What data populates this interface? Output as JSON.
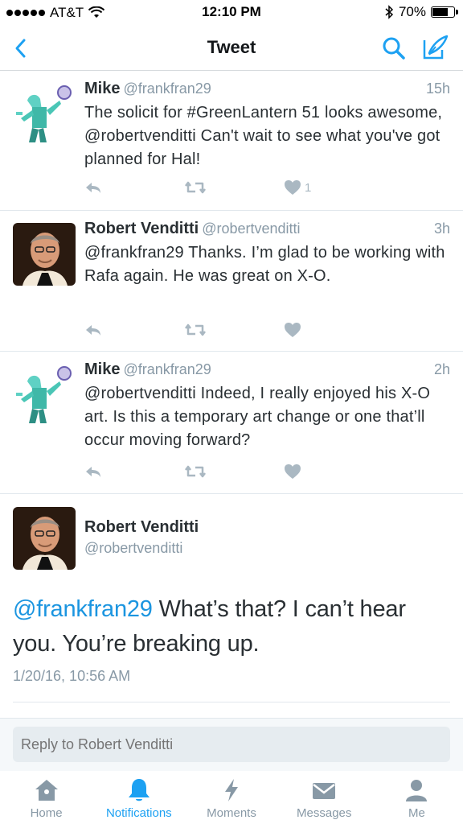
{
  "status_bar": {
    "carrier": "AT&T",
    "time": "12:10 PM",
    "battery": "70%",
    "battery_level": 0.7
  },
  "nav": {
    "title": "Tweet"
  },
  "tweets": [
    {
      "name": "Mike",
      "handle": "@frankfran29",
      "time": "15h",
      "text": "The solicit for #GreenLantern 51 looks awesome, @robertvenditti  Can't wait to see what you've got planned for Hal!",
      "likes": "1",
      "avatar": "green-lantern-avatar"
    },
    {
      "name": "Robert Venditti",
      "handle": "@robertvenditti",
      "time": "3h",
      "text": "@frankfran29 Thanks. I’m glad to be working with Rafa again. He was great on X-O.",
      "likes": "",
      "avatar": "robert-photo-avatar"
    },
    {
      "name": "Mike",
      "handle": "@frankfran29",
      "time": "2h",
      "text": "@robertvenditti Indeed, I really enjoyed his X-O art.  Is this a temporary art change or one that’ll occur moving forward?",
      "likes": "",
      "avatar": "green-lantern-avatar"
    }
  ],
  "main_tweet": {
    "name": "Robert Venditti",
    "handle": "@robertvenditti",
    "mention": "@frankfran29",
    "text": " What’s that? I can’t hear you. You’re breaking up.",
    "date": "1/20/16, 10:56 AM"
  },
  "reply": {
    "placeholder": "Reply to Robert Venditti"
  },
  "tabs": [
    {
      "label": "Home",
      "icon": "home-icon",
      "active": false
    },
    {
      "label": "Notifications",
      "icon": "bell-icon",
      "active": true
    },
    {
      "label": "Moments",
      "icon": "lightning-icon",
      "active": false
    },
    {
      "label": "Messages",
      "icon": "envelope-icon",
      "active": false
    },
    {
      "label": "Me",
      "icon": "person-icon",
      "active": false
    }
  ],
  "colors": {
    "accent": "#1da1f2",
    "text": "#292f33",
    "secondary": "#8899a6",
    "icon_gray": "#aab8c2"
  }
}
